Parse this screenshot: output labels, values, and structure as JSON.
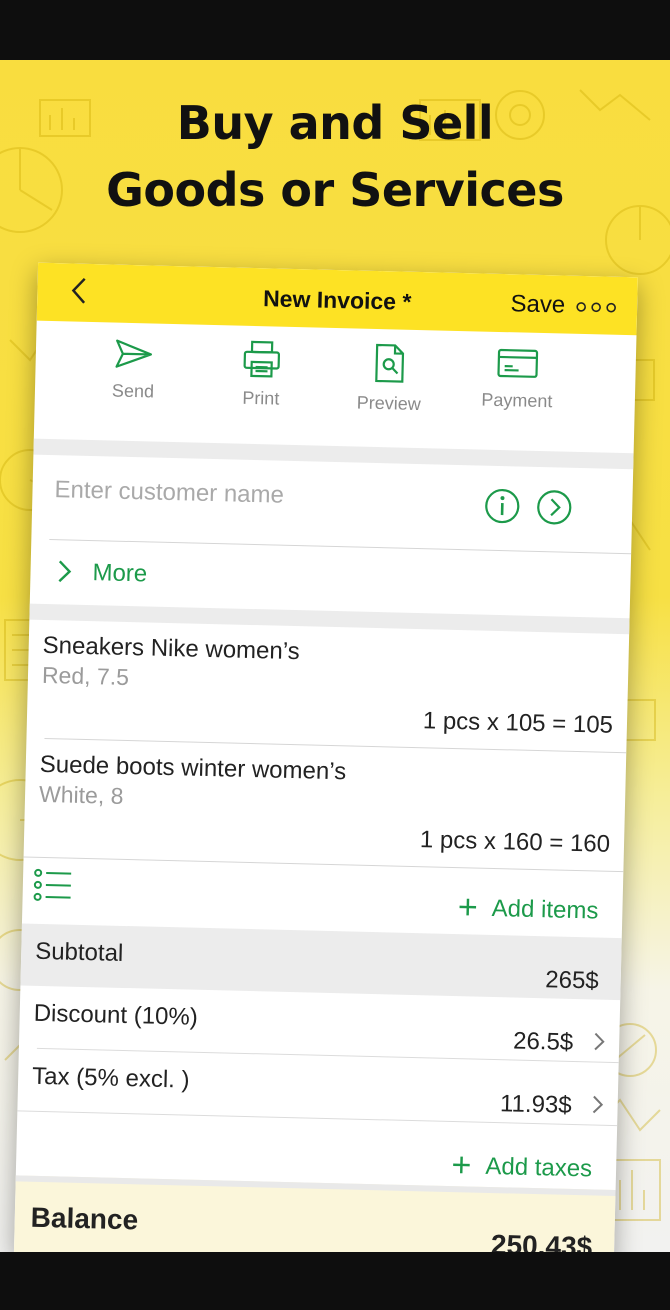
{
  "headline": {
    "line1": "Buy and Sell",
    "line2": "Goods or Services"
  },
  "nav": {
    "title": "New Invoice *",
    "save_label": "Save",
    "back_icon": "chevron-left-icon",
    "more_icon": "more-dots-icon"
  },
  "toolbar": {
    "send": "Send",
    "print": "Print",
    "preview": "Preview",
    "payment": "Payment"
  },
  "customer": {
    "placeholder": "Enter customer name",
    "more_label": "More"
  },
  "items": [
    {
      "name": "Sneakers Nike women’s",
      "desc": "Red, 7.5",
      "calc": "1 pcs x 105 = 105"
    },
    {
      "name": "Suede boots winter women’s",
      "desc": "White, 8",
      "calc": "1 pcs x 160 = 160"
    }
  ],
  "add_items": {
    "label": "Add  items"
  },
  "totals": {
    "subtotal_label": "Subtotal",
    "subtotal_value": "265$",
    "discount_label": "Discount (10%)",
    "discount_value": "26.5$",
    "tax_label": "Tax (5% excl. )",
    "tax_value": "11.93$"
  },
  "add_taxes": {
    "label": "Add taxes"
  },
  "balance": {
    "label": "Balance",
    "value": "250.43$"
  },
  "colors": {
    "accent_green": "#1c9a4a",
    "nav_yellow": "#fde224",
    "background_yellow": "#f9dd3f"
  }
}
